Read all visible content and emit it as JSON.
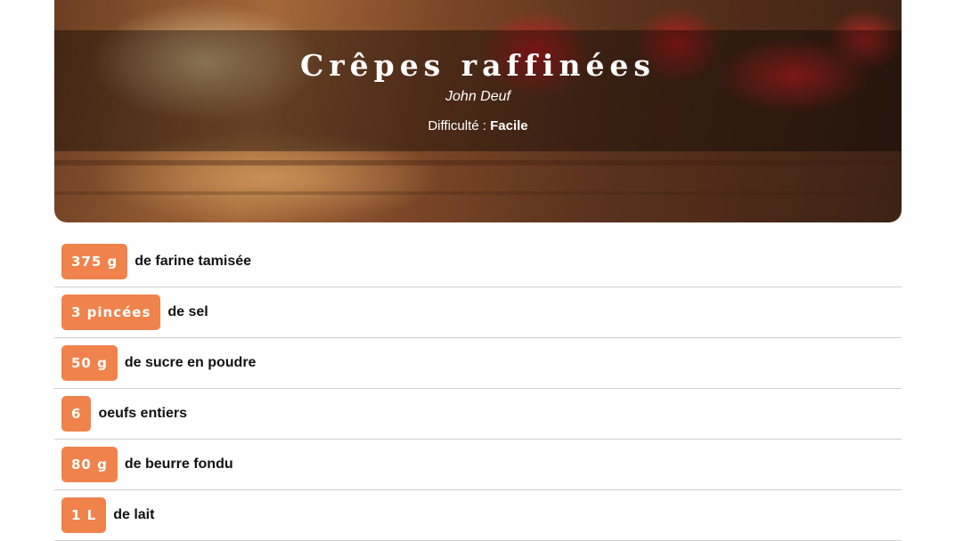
{
  "recipe": {
    "title": "Crêpes raffinées",
    "author": "John Deuf",
    "difficulty_label": "Difficulté :",
    "difficulty_value": "Facile"
  },
  "ingredients": [
    {
      "quantity": "375 g",
      "name": "de farine tamisée"
    },
    {
      "quantity": "3 pincées",
      "name": "de sel"
    },
    {
      "quantity": "50 g",
      "name": "de sucre en poudre"
    },
    {
      "quantity": "6",
      "name": "oeufs entiers"
    },
    {
      "quantity": "80 g",
      "name": "de beurre fondu"
    },
    {
      "quantity": "1 L",
      "name": "de lait"
    }
  ],
  "colors": {
    "quantity_badge": "#f0834c",
    "divider": "#cfcfcf"
  }
}
